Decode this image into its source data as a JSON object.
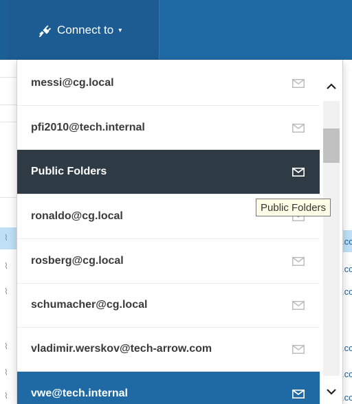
{
  "header": {
    "connect_label": "Connect to",
    "plug_icon": "plug-icon",
    "caret_icon": "caret-down-icon"
  },
  "dropdown": {
    "items": [
      {
        "label": "messi@cg.local",
        "state": "normal"
      },
      {
        "label": "pfi2010@tech.internal",
        "state": "normal"
      },
      {
        "label": "Public Folders",
        "state": "hovered"
      },
      {
        "label": "ronaldo@cg.local",
        "state": "normal"
      },
      {
        "label": "rosberg@cg.local",
        "state": "normal"
      },
      {
        "label": "schumacher@cg.local",
        "state": "normal"
      },
      {
        "label": "vladimir.werskov@tech-arrow.com",
        "state": "normal"
      },
      {
        "label": "vwe@tech.internal",
        "state": "selected"
      }
    ]
  },
  "tooltip": {
    "text": "Public Folders"
  },
  "background_page": {
    "right_snippets": [
      ".cc",
      ".cc",
      ".cc",
      ".cc",
      ".cc",
      ".cc"
    ]
  },
  "colors": {
    "topbar": "#1f6aa5",
    "hover_item": "#2e3a44",
    "selected_item": "#1f6aa5",
    "text_dark": "#3a3a3a"
  }
}
